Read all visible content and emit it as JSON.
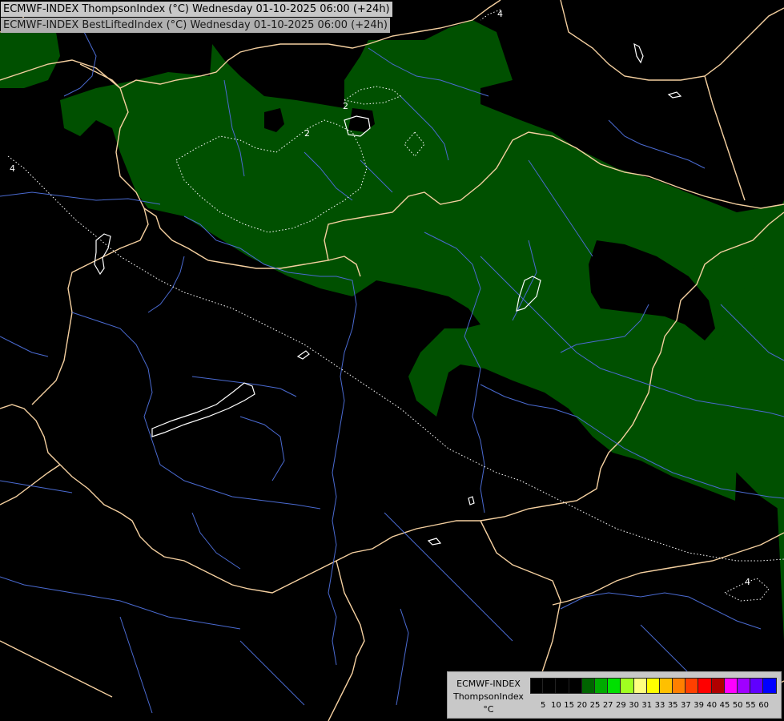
{
  "titles": {
    "line1": "ECMWF-INDEX ThompsonIndex (°C) Wednesday 01-10-2025 06:00 (+24h)",
    "line2": "ECMWF-INDEX BestLiftedIndex (°C) Wednesday 01-10-2025 06:00 (+24h)"
  },
  "legend": {
    "label1": "ECMWF-INDEX",
    "label2": "ThompsonIndex",
    "label3": "°C",
    "ticks": [
      "5",
      "10",
      "15",
      "20",
      "25",
      "27",
      "29",
      "30",
      "31",
      "33",
      "35",
      "37",
      "39",
      "40",
      "45",
      "50",
      "55",
      "60"
    ],
    "colors": [
      "#000000",
      "#000000",
      "#000000",
      "#000000",
      "#006400",
      "#00aa00",
      "#00e000",
      "#a0ff20",
      "#ffff80",
      "#ffff00",
      "#ffc000",
      "#ff8000",
      "#ff4000",
      "#ff0000",
      "#b00000",
      "#ff00ff",
      "#a000ff",
      "#6000ff",
      "#0000ff"
    ]
  },
  "contour_labels": [
    "4",
    "2",
    "2",
    "4",
    "4"
  ],
  "colors": {
    "fill_20_25": "#005000",
    "borders": "#f5d0a0",
    "rivers": "#4a6ad0",
    "contours": "#ffffff",
    "background": "#000000"
  }
}
